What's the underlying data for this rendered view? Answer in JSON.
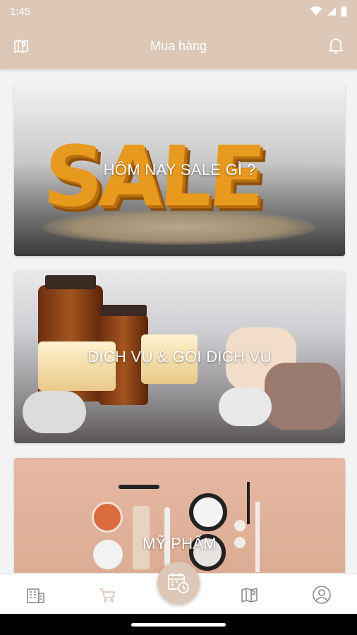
{
  "status_bar": {
    "time": "1:45"
  },
  "header": {
    "title": "Mua hàng"
  },
  "cards": [
    {
      "label": "HÔM NAY SALE GÌ ?",
      "art_text": "SALE"
    },
    {
      "label": "DỊCH VỤ & GÓI DỊCH VỤ"
    },
    {
      "label": "MỸ PHẨM"
    }
  ],
  "bottom_nav": {
    "items": [
      "building-icon",
      "cart-icon",
      "calendar-clock-icon",
      "map-pin-icon",
      "user-icon"
    ],
    "active_color": "#ddc8b8",
    "inactive_color": "#8a8a8a"
  },
  "colors": {
    "accent": "#ddc8b8",
    "background": "#f2f3f5"
  }
}
